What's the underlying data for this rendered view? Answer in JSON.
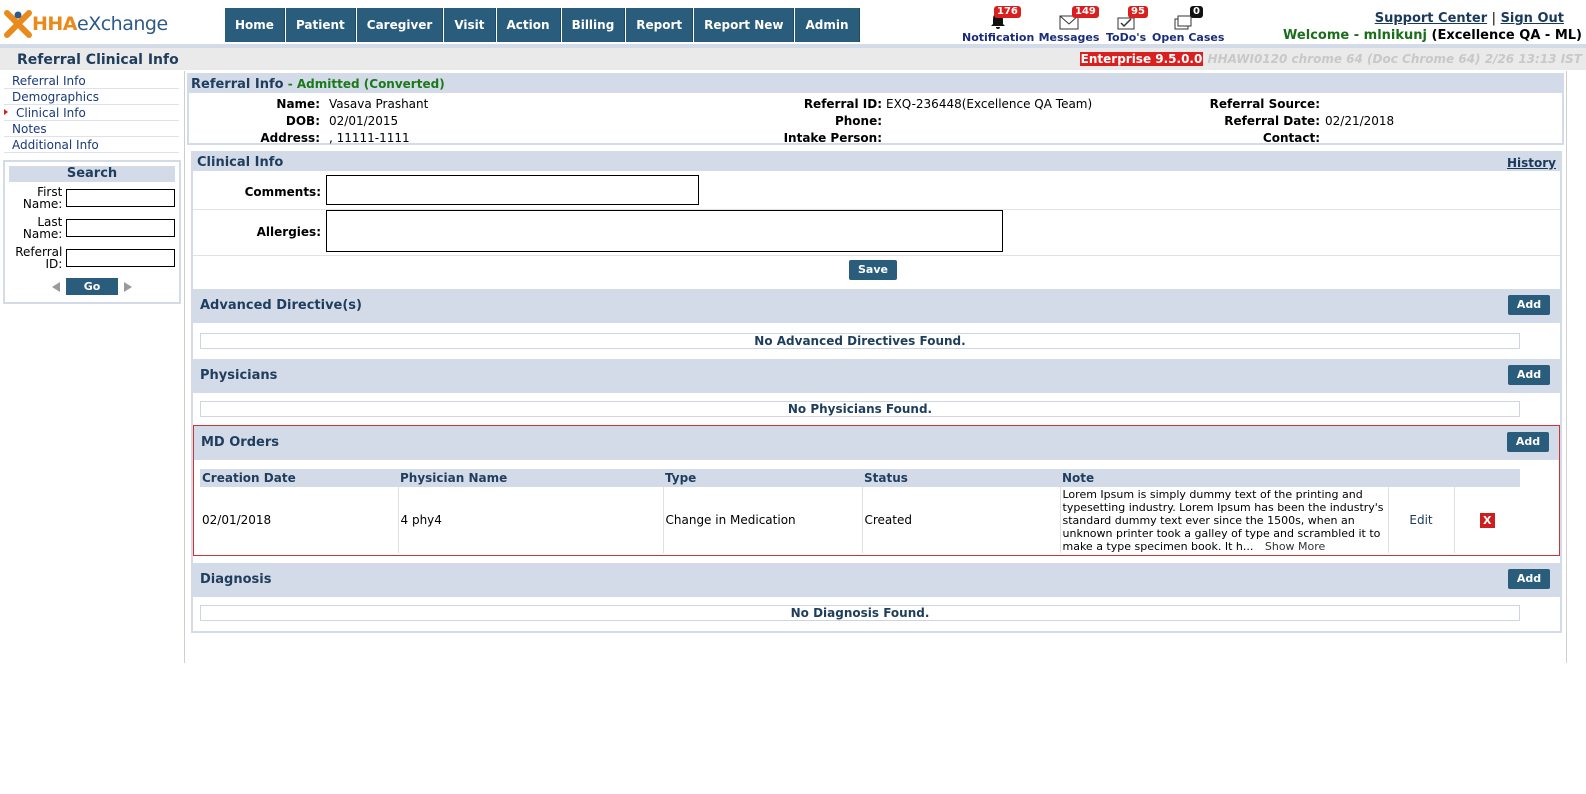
{
  "header": {
    "logo_hha": "HHA",
    "logo_exchange": "eXchange",
    "nav": [
      "Home",
      "Patient",
      "Caregiver",
      "Visit",
      "Action",
      "Billing",
      "Report",
      "Report New",
      "Admin"
    ],
    "notifications": [
      {
        "label": "Notification",
        "count": "176",
        "icon": "bell-icon"
      },
      {
        "label": "Messages",
        "count": "149",
        "icon": "envelope-icon"
      },
      {
        "label": "ToDo's",
        "count": "95",
        "icon": "todo-icon"
      },
      {
        "label": "Open Cases",
        "count": "0",
        "icon": "cases-icon"
      }
    ],
    "support_center": "Support Center",
    "separator": "|",
    "sign_out": "Sign Out",
    "welcome_prefix": "Welcome - ",
    "welcome_user": "mlnikunj",
    "welcome_org": "(Excellence QA - ML)"
  },
  "titlebar": {
    "title": "Referral Clinical Info",
    "version": "Enterprise 9.5.0.0",
    "build_info": "HHAWI0120 chrome 64 (Doc Chrome 64) 2/26 13:13 IST"
  },
  "leftnav": {
    "items": [
      "Referral Info",
      "Demographics",
      "Clinical Info",
      "Notes",
      "Additional Info"
    ],
    "active_index": 2
  },
  "search": {
    "title": "Search",
    "first_name_label": "First Name:",
    "last_name_label": "Last Name:",
    "referral_id_label": "Referral ID:",
    "go_label": "Go"
  },
  "referral": {
    "title": "Referral Info",
    "status": " - Admitted (Converted)",
    "name_label": "Name:",
    "name": "Vasava Prashant",
    "dob_label": "DOB:",
    "dob": "02/01/2015",
    "address_label": "Address:",
    "address": ", 11111-1111",
    "referral_id_label": "Referral ID:",
    "referral_id": "EXQ-236448(Excellence QA Team)",
    "phone_label": "Phone:",
    "phone": "",
    "intake_label": "Intake Person:",
    "intake": "",
    "source_label": "Referral Source:",
    "source": "",
    "date_label": "Referral Date:",
    "date": "02/21/2018",
    "contact_label": "Contact:",
    "contact": ""
  },
  "clinical": {
    "title": "Clinical Info",
    "history": "History",
    "comments_label": "Comments:",
    "allergies_label": "Allergies:",
    "save": "Save",
    "add": "Add",
    "advanced_title": "Advanced Directive(s)",
    "advanced_empty": "No Advanced Directives Found.",
    "physicians_title": "Physicians",
    "physicians_empty": "No Physicians Found.",
    "md_title": "MD Orders",
    "md_columns": [
      "Creation Date",
      "Physician Name",
      "Type",
      "Status",
      "Note"
    ],
    "md_rows": [
      {
        "date": "02/01/2018",
        "physician": "4 phy4",
        "type": "Change in Medication",
        "status": "Created",
        "note": "Lorem Ipsum is simply dummy text of the printing and typesetting industry. Lorem Ipsum has been the industry's standard dummy text ever since the 1500s, when an unknown printer took a galley of type and scrambled it to make a type specimen book. It h...",
        "show_more": "Show More",
        "edit": "Edit",
        "delete": "X"
      }
    ],
    "diagnosis_title": "Diagnosis",
    "diagnosis_empty": "No Diagnosis Found."
  },
  "colors": {
    "nav_bg": "#2a5d7c",
    "section_bg": "#d4dbe8",
    "badge_red": "#d9201f"
  }
}
